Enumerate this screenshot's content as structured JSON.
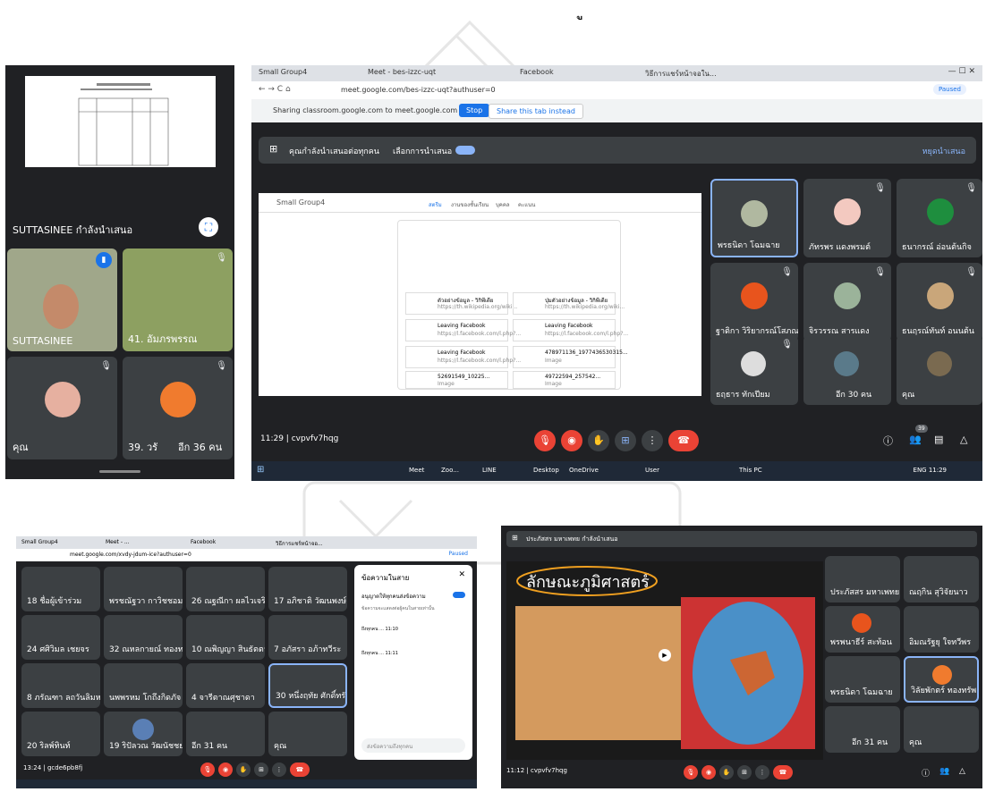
{
  "watermark": {
    "top_char": "ู"
  },
  "phone": {
    "presenter_label": "SUTTASINEE กำลังนำเสนอ",
    "tiles": [
      {
        "name": "SUTTASINEE"
      },
      {
        "name": "41. อัมภรพรรณ"
      },
      {
        "name": "คุณ"
      },
      {
        "name": "39. วรั"
      }
    ],
    "more_label": "อีก 36 คน"
  },
  "desktop": {
    "tabs": [
      "Small Group4",
      "Meet - bes-izzc-uqt",
      "Facebook",
      "วิธีการแชร์หน้าจอใน..."
    ],
    "url": "meet.google.com/bes-izzc-uqt?authuser=0",
    "paused": "Paused",
    "sharing_text": "Sharing classroom.google.com to meet.google.com",
    "stop_label": "Stop",
    "share_instead_label": "Share this tab instead",
    "presenting_text": "คุณกำลังนำเสนอต่อทุกคน",
    "presenting_option": "เลือกการนำเสนอ",
    "stop_presenting": "หยุดนำเสนอ",
    "classroom_title": "Small Group4",
    "classroom_tabs": [
      "สตรีม",
      "งานของชั้นเรียน",
      "บุคคล",
      "คะแนน"
    ],
    "attachments": [
      {
        "title": "ตัวอย่างข้อมูล - วิกิพีเดีย",
        "sub": "https://th.wikipedia.org/wiki..."
      },
      {
        "title": "ปุ่มตัวอย่างข้อมูล - วิกิพีเดีย",
        "sub": "https://th.wikipedia.org/wiki..."
      },
      {
        "title": "Leaving Facebook",
        "sub": "https://l.facebook.com/l.php?..."
      },
      {
        "title": "Leaving Facebook",
        "sub": "https://l.facebook.com/l.php?..."
      },
      {
        "title": "Leaving Facebook",
        "sub": "https://l.facebook.com/l.php?..."
      },
      {
        "title": "478971136_1977436530315...",
        "sub": "Image"
      },
      {
        "title": "52691549_10225...",
        "sub": "Image"
      },
      {
        "title": "49722594_257542...",
        "sub": "Image"
      }
    ],
    "participants": [
      {
        "name": "พรธนิดา โฉมฉาย"
      },
      {
        "name": "ภัทรพร แดงพรมต์"
      },
      {
        "name": "ธนากรณ์ อ่อนต้นกิจ"
      },
      {
        "name": "ฐาติกา วิริยากรณ์โสภณ"
      },
      {
        "name": "จิรวรรณ สารแดง"
      },
      {
        "name": "ธนฤรณ์ทันท์ อนนต้น"
      },
      {
        "name": "ธฤธาร ทักเปียม"
      },
      {
        "name": "อีก 30 คน"
      },
      {
        "name": "คุณ"
      }
    ],
    "time_code": "11:29 | cvpvfv7hqg",
    "badge": "39",
    "taskbar": [
      "Meet",
      "Zoo...",
      "LINE",
      "Desktop",
      "OneDrive",
      "User",
      "This PC"
    ],
    "tray_text": "ENG 11:29"
  },
  "bottom_left": {
    "tabs": [
      "Small Group4",
      "Meet - ...",
      "Facebook",
      "วิธีการแชร์หน้าจอ..."
    ],
    "url": "meet.google.com/xvdy-jdum-ice?authuser=0",
    "paused": "Paused",
    "participants": [
      {
        "name": "18 ชื่อผู้เข้าร่วม"
      },
      {
        "name": "พรชณัฐวา กาวิชชอม"
      },
      {
        "name": "26 ณฐณีกา ผลไวเจริญกุ"
      },
      {
        "name": "17 อภิชาติ วัฒนพงษ์"
      },
      {
        "name": "24 ศศิวิมล เชยจร"
      },
      {
        "name": "32 ณหลกายณ์ ทองทอง"
      },
      {
        "name": "10 ณพิญญา สินธัตตา"
      },
      {
        "name": "7 อภัสรา อภ้าทวีระ"
      },
      {
        "name": "8 ภรัณฑา ลถวันลิมหะ"
      },
      {
        "name": "นพพรหม โกถึงกิดภัจ"
      },
      {
        "name": "4 จารีตาณศุชาดา"
      },
      {
        "name": "30 หนึ่งฤทัย ศักดิ์ทรัพย์"
      },
      {
        "name": "20 ริลพ์ทินท์"
      },
      {
        "name": "19 ริปัลวณ วัฒนัชชยงค์"
      },
      {
        "name": "อีก 31 คน"
      },
      {
        "name": "คุณ"
      }
    ],
    "chat_title": "ข้อความในสาย",
    "chat_toggle": "อนุญาตให้ทุกคนส่งข้อความ",
    "chat_msgs": [
      "ข้อความจะแสดงต่อผู้คนในสายเท่านั้น",
      "ถึงทุกคน ... 11:10",
      "ถึงทุกคน ... 11:11"
    ],
    "chat_input": "ส่งข้อความถึงทุกคน",
    "time_code": "13:24 | gcde6pb8fj"
  },
  "bottom_right": {
    "presenter_bar": "ประภัสสร มหาเพทย กำลังนำเสนอ",
    "slide_title": "ลักษณะภูมิศาสตร์",
    "participants": [
      {
        "name": "ประภัสสร มหาเพทย"
      },
      {
        "name": "ณฤกิน สุวิจัยนาว"
      },
      {
        "name": "พรพนาธีร์ สะท้อน"
      },
      {
        "name": "อิมณรัฐยุ ใจทวีพร"
      },
      {
        "name": "พรธนิดา โฉมฉาย"
      },
      {
        "name": "วิลัยพักตร์ ทองทรัพย์"
      },
      {
        "name": "อีก 31 คน"
      },
      {
        "name": "คุณ"
      }
    ],
    "time_code": "11:12 | cvpvfv7hqg"
  }
}
